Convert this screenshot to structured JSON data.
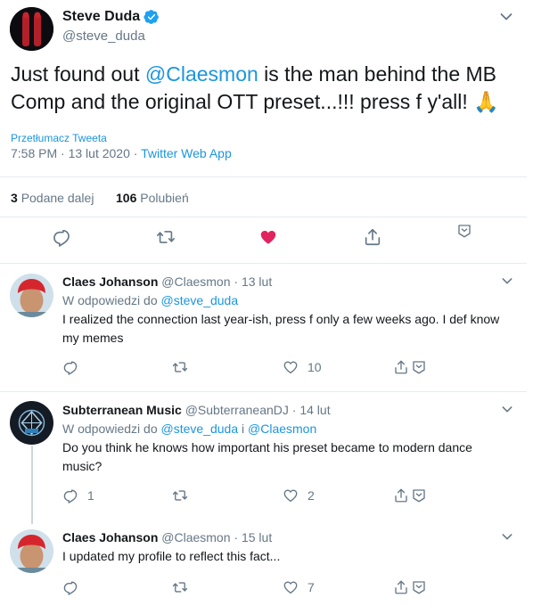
{
  "main_tweet": {
    "name": "Steve Duda",
    "handle": "@steve_duda",
    "text_before": "Just found out ",
    "mention": "@Claesmon",
    "text_after": " is the man behind the MB Comp and the original OTT preset...!!! press f y'all! 🙏",
    "translate_label": "Przetłumacz Tweeta",
    "time": "7:58 PM · 13 lut 2020 · ",
    "client": "Twitter Web App",
    "retweet_count": "3",
    "retweet_label": "Podane dalej",
    "like_count": "106",
    "like_label": "Polubień"
  },
  "replies": [
    {
      "name": "Claes Johanson",
      "handle": "@Claesmon",
      "date": "· 13 lut",
      "reply_to_prefix": "W odpowiedzi do ",
      "reply_to_user": "@steve_duda",
      "reply_to_join": "",
      "reply_to_user2": "",
      "text": "I realized the connection last year-ish, press f only a few weeks ago. I def know my memes",
      "reply_count": "",
      "retweet_count": "",
      "like_count": "10"
    },
    {
      "name": "Subterranean Music",
      "handle": "@SubterraneanDJ",
      "date": "· 14 lut",
      "reply_to_prefix": "W odpowiedzi do ",
      "reply_to_user": "@steve_duda",
      "reply_to_join": " i ",
      "reply_to_user2": "@Claesmon",
      "text": "Do you think he knows how important his preset became to modern dance music?",
      "reply_count": "1",
      "retweet_count": "",
      "like_count": "2"
    },
    {
      "name": "Claes Johanson",
      "handle": "@Claesmon",
      "date": "· 15 lut",
      "reply_to_prefix": "",
      "reply_to_user": "",
      "reply_to_join": "",
      "reply_to_user2": "",
      "text": "I updated my profile to reflect this fact...",
      "reply_count": "",
      "retweet_count": "",
      "like_count": "7"
    }
  ],
  "colors": {
    "accent": "#1b95e0",
    "like": "#e0245e",
    "secondary_text": "#657786",
    "border": "#e6ecf0"
  },
  "icons": [
    "verified-icon",
    "chevron-down-icon",
    "reply-icon",
    "retweet-icon",
    "like-icon",
    "share-icon",
    "bookmark-icon"
  ]
}
